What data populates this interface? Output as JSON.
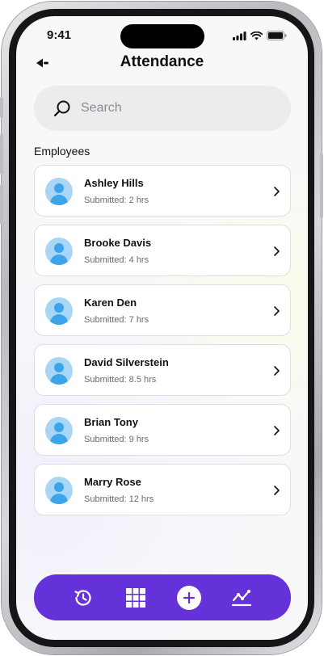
{
  "status_bar": {
    "time": "9:41"
  },
  "header": {
    "title": "Attendance"
  },
  "search": {
    "placeholder": "Search"
  },
  "section": {
    "label": "Employees"
  },
  "employees": [
    {
      "name": "Ashley Hills",
      "submitted": "Submitted: 2 hrs"
    },
    {
      "name": "Brooke Davis",
      "submitted": "Submitted: 4 hrs"
    },
    {
      "name": "Karen Den",
      "submitted": "Submitted: 7 hrs"
    },
    {
      "name": "David Silverstein",
      "submitted": "Submitted: 8.5 hrs"
    },
    {
      "name": "Brian Tony",
      "submitted": "Submitted: 9 hrs"
    },
    {
      "name": "Marry Rose",
      "submitted": "Submitted: 12 hrs"
    }
  ],
  "bottom_nav": {
    "items": [
      {
        "icon": "history-icon"
      },
      {
        "icon": "grid-icon"
      },
      {
        "icon": "add-icon"
      },
      {
        "icon": "analytics-icon"
      }
    ]
  },
  "colors": {
    "accent": "#6531d8",
    "avatar_bg": "#a9d6f5",
    "avatar_fg": "#3ba4ea",
    "screen_bg": "#f8f8fb"
  }
}
